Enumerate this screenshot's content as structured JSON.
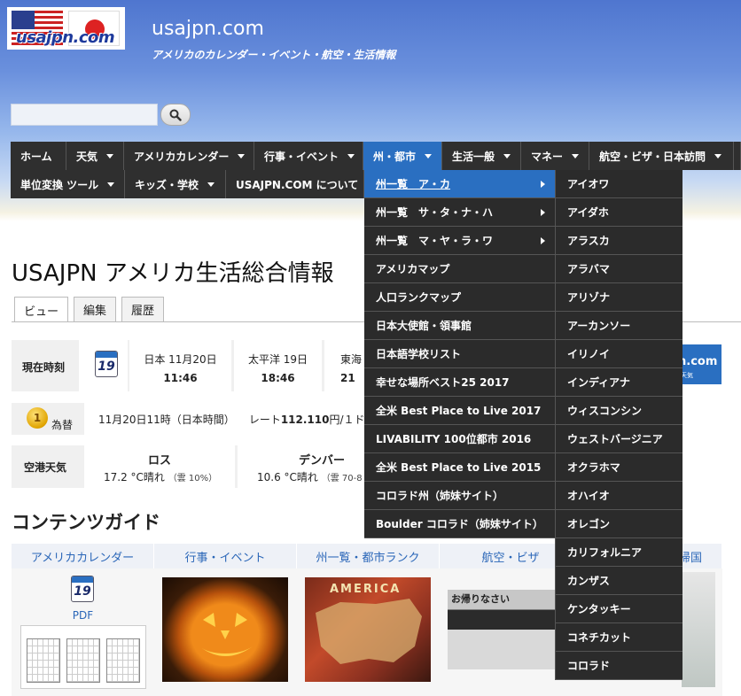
{
  "header": {
    "logo_text": "usajpn.com",
    "site_title": "usajpn.com",
    "tagline": "アメリカのカレンダー・イベント・航空・生活情報"
  },
  "search": {
    "value": "",
    "placeholder": ""
  },
  "nav": {
    "row1": [
      "ホーム",
      "天気",
      "アメリカカレンダー",
      "行事・イベント",
      "州・都市",
      "生活一般",
      "マネー",
      "航空・ビザ・日本訪問"
    ],
    "row2": [
      "単位変換 ツール",
      "キッズ・学校",
      "USAJPN.COM について"
    ]
  },
  "dropdown1": [
    "州一覧　ア・カ",
    "州一覧　サ・タ・ナ・ハ",
    "州一覧　マ・ヤ・ラ・ワ",
    "アメリカマップ",
    "人口ランクマップ",
    "日本大使館・領事館",
    "日本語学校リスト",
    "幸せな場所ベスト25 2017",
    "全米 Best Place to Live 2017",
    "LIVABILITY 100位都市 2016",
    "全米 Best Place to Live 2015",
    "コロラド州（姉妹サイト）",
    "Boulder コロラド（姉妹サイト）"
  ],
  "dropdown2": [
    "アイオワ",
    "アイダホ",
    "アラスカ",
    "アラバマ",
    "アリゾナ",
    "アーカンソー",
    "イリノイ",
    "インディアナ",
    "ウィスコンシン",
    "ウェストバージニア",
    "オクラホマ",
    "オハイオ",
    "オレゴン",
    "カリフォルニア",
    "カンザス",
    "ケンタッキー",
    "コネチカット",
    "コロラド"
  ],
  "page": {
    "title": "USAJPN アメリカ生活総合情報",
    "tabs": [
      "ビュー",
      "編集",
      "履歴"
    ]
  },
  "time_row": {
    "label": "現在時刻",
    "cal_day": "19",
    "zones": [
      {
        "name": "日本 11月20日",
        "time": "11:46"
      },
      {
        "name": "太平洋 19日",
        "time": "18:46"
      },
      {
        "name": "東海",
        "time": "21"
      }
    ]
  },
  "promo": {
    "text": "n.com",
    "sub": "天気"
  },
  "fx_row": {
    "label": "為替",
    "coin": "1",
    "datetime": "11月20日11時（日本時間）",
    "rate_prefix": "レート",
    "rate": "112.110",
    "rate_suffix": "円/１ド"
  },
  "weather_row": {
    "label": "空港天気",
    "cities": [
      {
        "name": "ロス",
        "temp": "17.2 °C晴れ",
        "cloud": "（雲 10%）"
      },
      {
        "name": "デンバー",
        "temp": "10.6 °C晴れ",
        "cloud": "（雲 70-8"
      }
    ]
  },
  "guide": {
    "title": "コンテンツガイド",
    "headers": [
      "アメリカカレンダー",
      "行事・イベント",
      "州一覧・都市ランク",
      "航空・ビザ",
      "帰国"
    ],
    "pdf_label": "PDF",
    "cal_day": "19",
    "map_word": "AMERICA",
    "airport_sign": "お帰りなさい"
  }
}
